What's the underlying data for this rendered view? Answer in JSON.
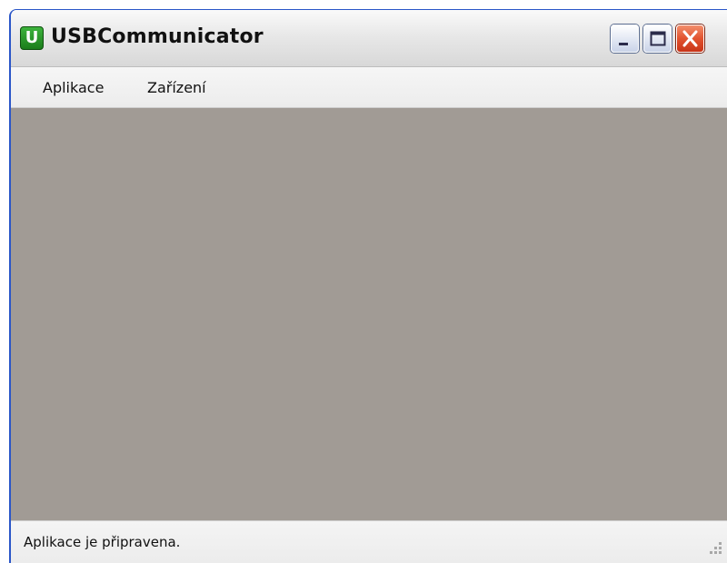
{
  "window": {
    "title": "USBCommunicator",
    "icon_letter": "U",
    "icon": "app-icon",
    "controls": {
      "minimize": "minimize-icon",
      "maximize": "maximize-icon",
      "close": "close-icon"
    }
  },
  "menu": {
    "items": [
      {
        "label": "Aplikace"
      },
      {
        "label": "Zařízení"
      }
    ]
  },
  "status": {
    "text": "Aplikace je připravena."
  },
  "colors": {
    "client_background": "#a19b95",
    "icon_green": "#2a9a2a",
    "close_red": "#e2532f"
  }
}
